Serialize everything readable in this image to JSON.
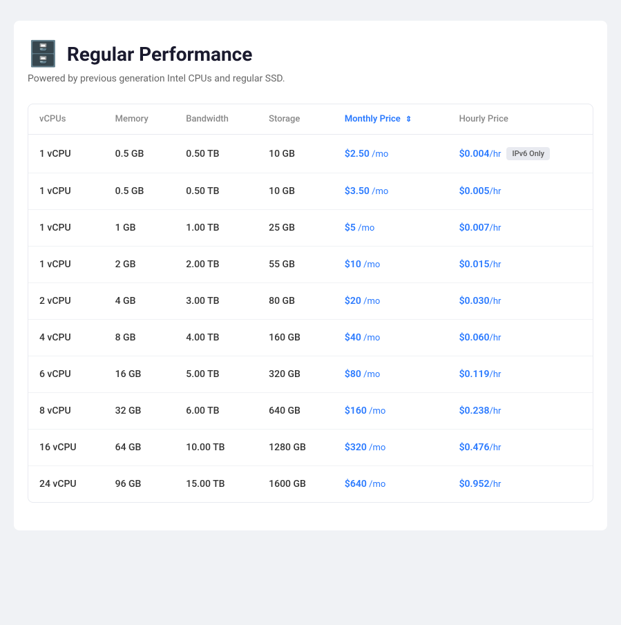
{
  "header": {
    "icon": "🗄️",
    "title": "Regular Performance",
    "subtitle": "Powered by previous generation Intel CPUs and regular SSD."
  },
  "table": {
    "columns": [
      {
        "key": "vcpus",
        "label": "vCPUs",
        "active": false
      },
      {
        "key": "memory",
        "label": "Memory",
        "active": false
      },
      {
        "key": "bandwidth",
        "label": "Bandwidth",
        "active": false
      },
      {
        "key": "storage",
        "label": "Storage",
        "active": false
      },
      {
        "key": "monthly",
        "label": "Monthly Price",
        "active": true
      },
      {
        "key": "hourly",
        "label": "Hourly Price",
        "active": false
      }
    ],
    "rows": [
      {
        "vcpus": "1 vCPU",
        "memory": "0.5 GB",
        "bandwidth": "0.50 TB",
        "storage": "10 GB",
        "monthly": "$2.50",
        "monthly_unit": "/mo",
        "hourly": "$0.004",
        "hourly_unit": "/hr",
        "badge": "IPv6 Only"
      },
      {
        "vcpus": "1 vCPU",
        "memory": "0.5 GB",
        "bandwidth": "0.50 TB",
        "storage": "10 GB",
        "monthly": "$3.50",
        "monthly_unit": "/mo",
        "hourly": "$0.005",
        "hourly_unit": "/hr",
        "badge": ""
      },
      {
        "vcpus": "1 vCPU",
        "memory": "1 GB",
        "bandwidth": "1.00 TB",
        "storage": "25 GB",
        "monthly": "$5",
        "monthly_unit": "/mo",
        "hourly": "$0.007",
        "hourly_unit": "/hr",
        "badge": ""
      },
      {
        "vcpus": "1 vCPU",
        "memory": "2 GB",
        "bandwidth": "2.00 TB",
        "storage": "55 GB",
        "monthly": "$10",
        "monthly_unit": "/mo",
        "hourly": "$0.015",
        "hourly_unit": "/hr",
        "badge": ""
      },
      {
        "vcpus": "2 vCPU",
        "memory": "4 GB",
        "bandwidth": "3.00 TB",
        "storage": "80 GB",
        "monthly": "$20",
        "monthly_unit": "/mo",
        "hourly": "$0.030",
        "hourly_unit": "/hr",
        "badge": ""
      },
      {
        "vcpus": "4 vCPU",
        "memory": "8 GB",
        "bandwidth": "4.00 TB",
        "storage": "160 GB",
        "monthly": "$40",
        "monthly_unit": "/mo",
        "hourly": "$0.060",
        "hourly_unit": "/hr",
        "badge": ""
      },
      {
        "vcpus": "6 vCPU",
        "memory": "16 GB",
        "bandwidth": "5.00 TB",
        "storage": "320 GB",
        "monthly": "$80",
        "monthly_unit": "/mo",
        "hourly": "$0.119",
        "hourly_unit": "/hr",
        "badge": ""
      },
      {
        "vcpus": "8 vCPU",
        "memory": "32 GB",
        "bandwidth": "6.00 TB",
        "storage": "640 GB",
        "monthly": "$160",
        "monthly_unit": "/mo",
        "hourly": "$0.238",
        "hourly_unit": "/hr",
        "badge": ""
      },
      {
        "vcpus": "16 vCPU",
        "memory": "64 GB",
        "bandwidth": "10.00 TB",
        "storage": "1280 GB",
        "monthly": "$320",
        "monthly_unit": "/mo",
        "hourly": "$0.476",
        "hourly_unit": "/hr",
        "badge": ""
      },
      {
        "vcpus": "24 vCPU",
        "memory": "96 GB",
        "bandwidth": "15.00 TB",
        "storage": "1600 GB",
        "monthly": "$640",
        "monthly_unit": "/mo",
        "hourly": "$0.952",
        "hourly_unit": "/hr",
        "badge": ""
      }
    ]
  }
}
